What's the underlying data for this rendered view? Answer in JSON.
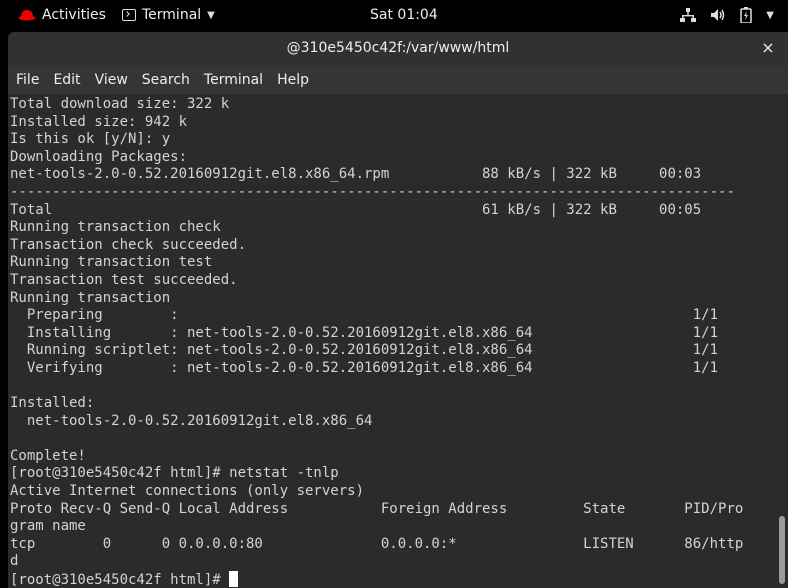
{
  "topbar": {
    "activities_label": "Activities",
    "app_label": "Terminal",
    "clock": "Sat 01:04",
    "icons": [
      "network-icon",
      "volume-icon",
      "battery-icon",
      "chevron-down-icon"
    ]
  },
  "window": {
    "title": "@310e5450c42f:/var/www/html",
    "close_label": "×"
  },
  "menubar": {
    "items": [
      "File",
      "Edit",
      "View",
      "Search",
      "Terminal",
      "Help"
    ]
  },
  "terminal": {
    "lines": [
      "Total download size: 322 k",
      "Installed size: 942 k",
      "Is this ok [y/N]: y",
      "Downloading Packages:",
      "net-tools-2.0-0.52.20160912git.el8.x86_64.rpm           88 kB/s | 322 kB     00:03",
      "--------------------------------------------------------------------------------------",
      "Total                                                   61 kB/s | 322 kB     00:05",
      "Running transaction check",
      "Transaction check succeeded.",
      "Running transaction test",
      "Transaction test succeeded.",
      "Running transaction",
      "  Preparing        :                                                             1/1",
      "  Installing       : net-tools-2.0-0.52.20160912git.el8.x86_64                   1/1",
      "  Running scriptlet: net-tools-2.0-0.52.20160912git.el8.x86_64                   1/1",
      "  Verifying        : net-tools-2.0-0.52.20160912git.el8.x86_64                   1/1",
      "",
      "Installed:",
      "  net-tools-2.0-0.52.20160912git.el8.x86_64",
      "",
      "Complete!",
      "[root@310e5450c42f html]# netstat -tnlp",
      "Active Internet connections (only servers)",
      "Proto Recv-Q Send-Q Local Address           Foreign Address         State       PID/Pro",
      "gram name",
      "tcp        0      0 0.0.0.0:80              0.0.0.0:*               LISTEN      86/http",
      "d"
    ],
    "prompt": "[root@310e5450c42f html]# "
  }
}
